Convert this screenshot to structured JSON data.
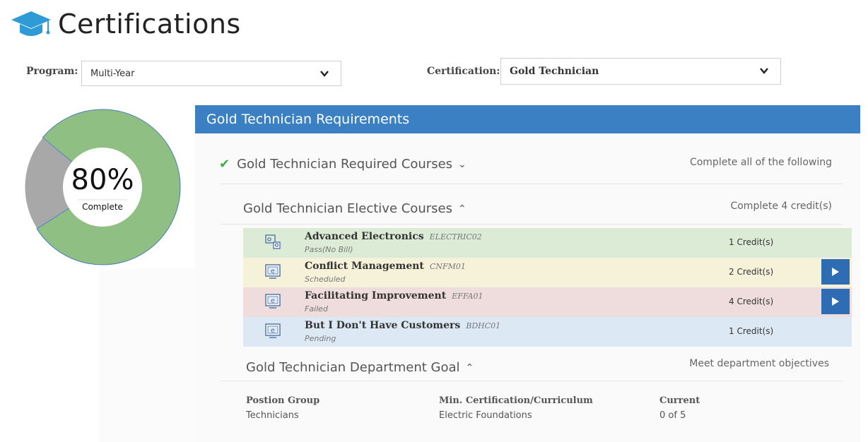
{
  "page": {
    "title": "Certifications"
  },
  "filters": {
    "program_label": "Program:",
    "program_value": "Multi-Year",
    "certification_label": "Certification:",
    "certification_value": "Gold Technician"
  },
  "progress": {
    "percent_text": "80%",
    "percent": 0.8,
    "label": "Complete",
    "complete_color": "#8fbf82",
    "remaining_color": "#a8a8a8"
  },
  "requirements": {
    "title": "Gold Technician Requirements",
    "accent": "#3a80c2",
    "sections": [
      {
        "title": "Gold Technician Required Courses",
        "note": "Complete all of the following",
        "completed": true,
        "expanded": false
      },
      {
        "title": "Gold Technician Elective Courses",
        "note": "Complete 4 credit(s)",
        "completed": false,
        "expanded": true
      },
      {
        "title": "Gold Technician Department Goal",
        "note": "Meet department objectives",
        "completed": false,
        "expanded": true
      }
    ],
    "courses": [
      {
        "name": "Advanced Electronics",
        "code": "ELECTRIC02",
        "status": "Pass(No Bill)",
        "credits": "1 Credit(s)",
        "icon": "classroom-icon",
        "color": "#dcebd6",
        "launch": false
      },
      {
        "name": "Conflict Management",
        "code": "CNFM01",
        "status": "Scheduled",
        "credits": "2 Credit(s)",
        "icon": "elearning-icon",
        "color": "#f6f1d9",
        "launch": true
      },
      {
        "name": "Facilitating Improvement",
        "code": "EFFA01",
        "status": "Failed",
        "credits": "4 Credit(s)",
        "icon": "elearning-icon",
        "color": "#efdcdd",
        "launch": true
      },
      {
        "name": "But I Don't Have Customers",
        "code": "BDHC01",
        "status": "Pending",
        "credits": "1 Credit(s)",
        "icon": "elearning-icon",
        "color": "#dce9f4",
        "launch": false
      }
    ],
    "goal": {
      "columns": [
        {
          "header": "Postion Group",
          "value": "Technicians"
        },
        {
          "header": "Min. Certification/Curriculum",
          "value": "Electric Foundations"
        },
        {
          "header": "Current",
          "value": "0 of 5"
        }
      ]
    }
  }
}
